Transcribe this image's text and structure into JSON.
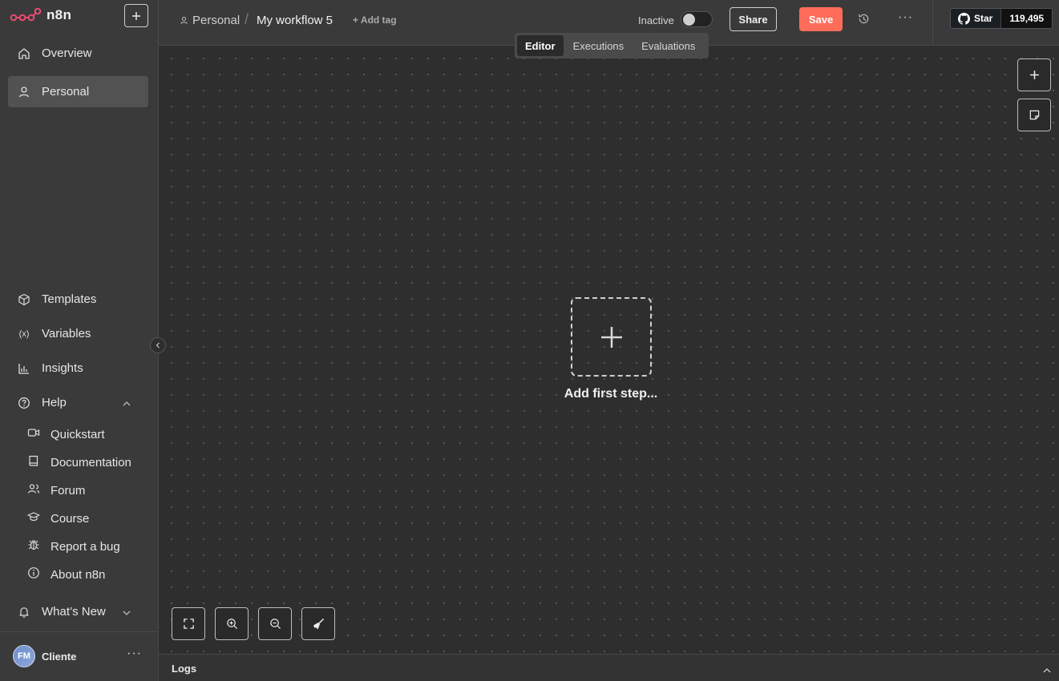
{
  "app": {
    "logo_text": "n8n",
    "accent": "#ff6d5a"
  },
  "sidebar": {
    "top_items": [
      {
        "label": "Overview",
        "icon": "home-icon"
      },
      {
        "label": "Personal",
        "icon": "user-icon",
        "active": true
      }
    ],
    "bottom_items": [
      {
        "label": "Templates",
        "icon": "box-icon"
      },
      {
        "label": "Variables",
        "icon": "variables-icon"
      },
      {
        "label": "Insights",
        "icon": "bar-chart-icon"
      },
      {
        "label": "Help",
        "icon": "help-circle-icon",
        "expanded": true
      }
    ],
    "help_items": [
      {
        "label": "Quickstart",
        "icon": "video-icon"
      },
      {
        "label": "Documentation",
        "icon": "book-icon"
      },
      {
        "label": "Forum",
        "icon": "users-icon"
      },
      {
        "label": "Course",
        "icon": "graduation-cap-icon"
      },
      {
        "label": "Report a bug",
        "icon": "bug-icon"
      },
      {
        "label": "About n8n",
        "icon": "info-icon"
      }
    ],
    "whats_new": "What’s New",
    "user": {
      "initials": "FM",
      "name": "Cliente",
      "more": "···"
    }
  },
  "header": {
    "breadcrumb_project": "Personal",
    "breadcrumb_sep": "/",
    "workflow_name": "My workflow 5",
    "add_tag": "+ Add tag",
    "status_label": "Inactive",
    "share_label": "Share",
    "save_label": "Save",
    "more": "···",
    "github": {
      "star_label": "Star",
      "count": "119,495"
    }
  },
  "tabs": [
    {
      "label": "Editor",
      "active": true
    },
    {
      "label": "Executions"
    },
    {
      "label": "Evaluations"
    }
  ],
  "canvas": {
    "add_first_step": "Add first step..."
  },
  "logs": {
    "label": "Logs"
  }
}
